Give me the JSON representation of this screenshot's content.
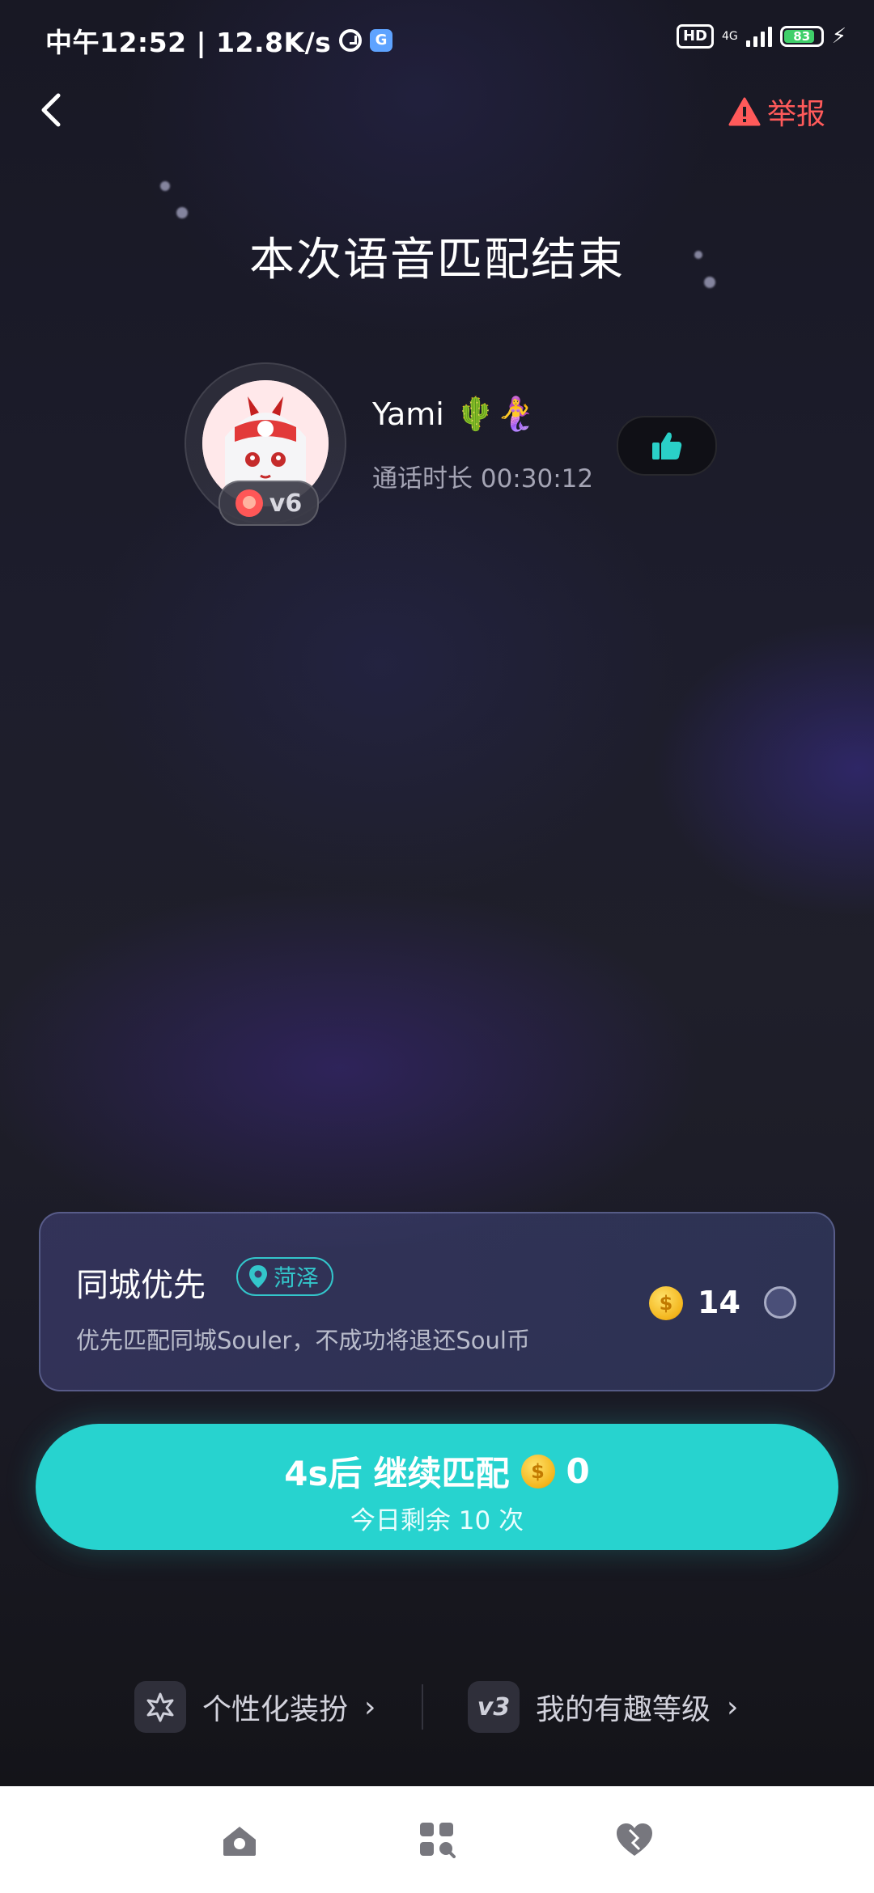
{
  "status_bar": {
    "time": "中午12:52 | 12.8K/s",
    "hd": "HD",
    "network": "4G",
    "battery": "83",
    "battery_level": 0.83
  },
  "header": {
    "report_label": "举报"
  },
  "title": "本次语音匹配结束",
  "partner": {
    "name": "Yami",
    "name_emojis": "🌵🧜‍♀️",
    "level": "v6",
    "duration": "通话时长 00:30:12"
  },
  "city_priority": {
    "title": "同城优先",
    "location": "菏泽",
    "description": "优先匹配同城Souler，不成功将退还Soul币",
    "cost": "14",
    "selected": false
  },
  "match_button": {
    "countdown": "4s后",
    "label": "继续匹配",
    "cost": "0",
    "remaining": "今日剩余 10 次"
  },
  "bottom_links": {
    "customize": "个性化装扮",
    "level": "我的有趣等级",
    "level_badge": "v3"
  },
  "icons": {
    "back": "back-arrow-icon",
    "report": "warning-icon",
    "like": "thumbs-up-icon",
    "location": "location-pin-icon",
    "coin": "soul-coin-icon",
    "home": "home-icon",
    "square": "square-icon",
    "heart": "heart-icon"
  },
  "colors": {
    "accent": "#27d3cf",
    "report": "#ff5a5a",
    "coin": "#f3b51c"
  }
}
